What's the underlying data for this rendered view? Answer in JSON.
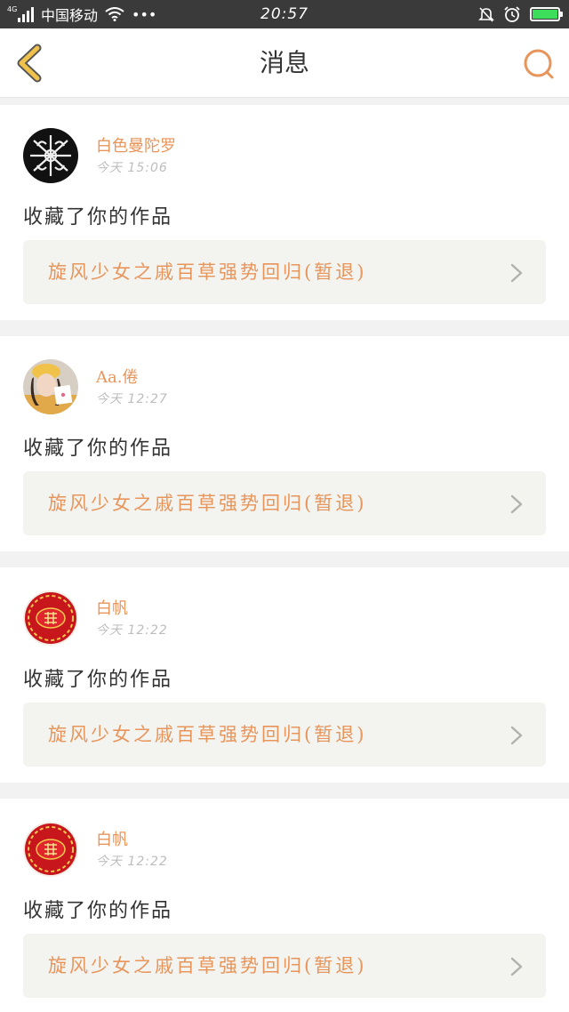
{
  "status_bar": {
    "network": "4G",
    "carrier": "中国移动",
    "more": "•••",
    "time": "20:57",
    "battery_level": 1.0
  },
  "header": {
    "title": "消息"
  },
  "colors": {
    "accent": "#e8955b",
    "back_arrow": "#f0c14b",
    "battery_fill": "#3ddc5a"
  },
  "messages": [
    {
      "user": "白色曼陀罗",
      "time": "今天 15:06",
      "action": "收藏了你的作品",
      "work": "旋风少女之戚百草强势回归(暂退)",
      "avatar": "white-flower-avatar"
    },
    {
      "user": "Aa.倦",
      "time": "今天 12:27",
      "action": "收藏了你的作品",
      "work": "旋风少女之戚百草强势回归(暂退)",
      "avatar": "girl-photo-avatar"
    },
    {
      "user": "白帆",
      "time": "今天 12:22",
      "action": "收藏了你的作品",
      "work": "旋风少女之戚百草强势回归(暂退)",
      "avatar": "red-seal-avatar"
    },
    {
      "user": "白帆",
      "time": "今天 12:22",
      "action": "收藏了你的作品",
      "work": "旋风少女之戚百草强势回归(暂退)",
      "avatar": "red-seal-avatar"
    }
  ]
}
